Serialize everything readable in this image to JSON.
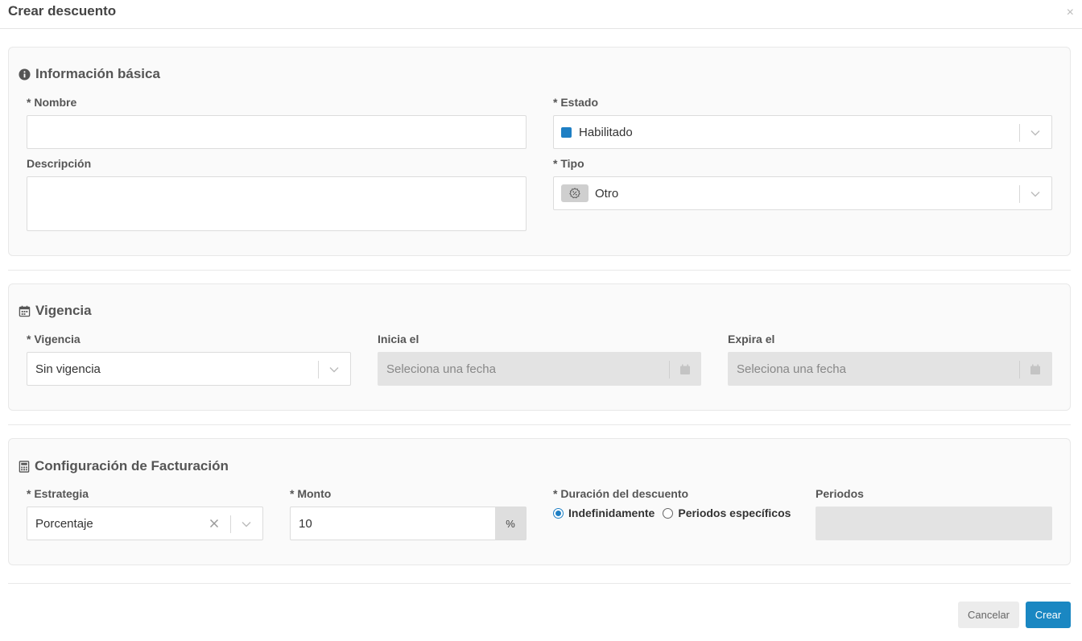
{
  "modal": {
    "title": "Crear descuento",
    "close": "×"
  },
  "basic": {
    "title": "Información básica",
    "nombre_label": "* Nombre",
    "nombre_value": "",
    "descripcion_label": "Descripción",
    "descripcion_value": "",
    "estado_label": "* Estado",
    "estado_value": "Habilitado",
    "estado_color": "#1e7fc4",
    "tipo_label": "* Tipo",
    "tipo_value": "Otro",
    "tipo_icon": "discount-badge-icon"
  },
  "vigencia": {
    "title": "Vigencia",
    "vigencia_label": "* Vigencia",
    "vigencia_value": "Sin vigencia",
    "inicia_label": "Inicia el",
    "inicia_placeholder": "Seleciona una fecha",
    "expira_label": "Expira el",
    "expira_placeholder": "Seleciona una fecha"
  },
  "billing": {
    "title": "Configuración de Facturación",
    "estrategia_label": "* Estrategia",
    "estrategia_value": "Porcentaje",
    "monto_label": "* Monto",
    "monto_value": "10",
    "monto_suffix": "%",
    "duracion_label": "* Duración del descuento",
    "duracion_options": [
      "Indefinidamente",
      "Periodos específicos"
    ],
    "duracion_selected": "Indefinidamente",
    "periodos_label": "Periodos",
    "periodos_value": ""
  },
  "footer": {
    "cancel_label": "Cancelar",
    "create_label": "Crear"
  },
  "colors": {
    "accent": "#1a87c2",
    "status": "#1e7fc4"
  }
}
